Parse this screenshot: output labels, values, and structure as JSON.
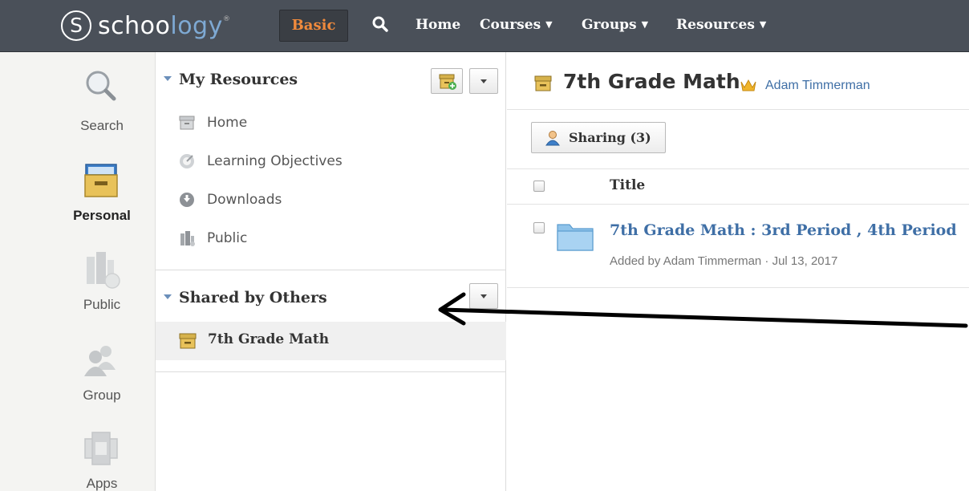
{
  "topbar": {
    "logo_mark": "S",
    "logo_part1": "schoo",
    "logo_part2": "logy",
    "logo_tm": "®",
    "mode_button": "Basic",
    "nav": [
      "Home",
      "Courses",
      "Groups",
      "Resources"
    ],
    "nav_caret": "▼"
  },
  "rail": {
    "items": [
      {
        "label": "Search",
        "icon": "magnifier-icon"
      },
      {
        "label": "Personal",
        "icon": "personal-box-icon",
        "active": true
      },
      {
        "label": "Public",
        "icon": "public-icon"
      },
      {
        "label": "Group",
        "icon": "group-icon"
      },
      {
        "label": "Apps",
        "icon": "apps-icon"
      }
    ]
  },
  "resources": {
    "my_title": "My Resources",
    "my_items": [
      {
        "label": "Home",
        "icon": "home-box-icon"
      },
      {
        "label": "Learning Objectives",
        "icon": "target-icon"
      },
      {
        "label": "Downloads",
        "icon": "download-icon"
      },
      {
        "label": "Public",
        "icon": "building-icon"
      }
    ],
    "shared_title": "Shared by Others",
    "shared_items": [
      {
        "label": "7th Grade Math",
        "icon": "collection-box-icon"
      }
    ]
  },
  "main": {
    "title": "7th Grade Math",
    "owner": "Adam Timmerman",
    "sharing_button": "Sharing (3)",
    "column_title": "Title",
    "rows": [
      {
        "title": "7th Grade Math : 3rd Period , 4th Period",
        "meta": "Added by Adam Timmerman · Jul 13, 2017",
        "icon": "folder-icon"
      }
    ]
  },
  "colors": {
    "topbar_bg": "#4a5059",
    "brand_blue": "#7ea9d3",
    "accent_orange": "#f08a3c",
    "link_blue": "#3f6fa6",
    "box_yellow": "#e8c25a"
  }
}
